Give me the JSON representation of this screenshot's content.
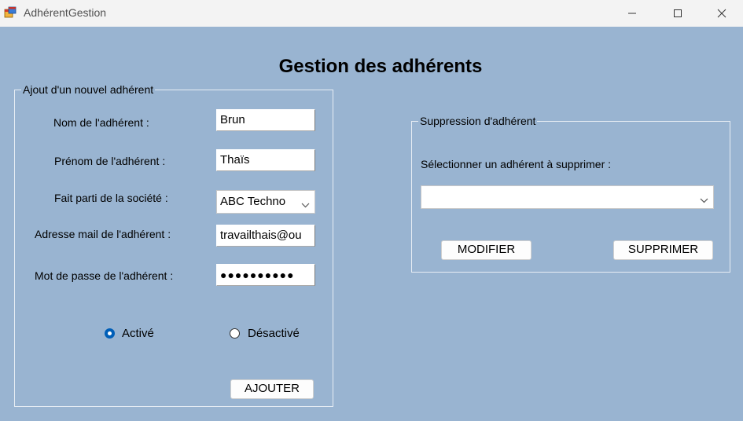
{
  "window": {
    "title": "AdhérentGestion",
    "icons": {
      "app": "app-window-icon",
      "minimize": "minimize-icon",
      "maximize": "maximize-icon",
      "close": "close-icon"
    }
  },
  "page": {
    "title": "Gestion des adhérents"
  },
  "add_group": {
    "legend": "Ajout d'un nouvel adhérent",
    "lastname_label": "Nom de l'adhérent :",
    "lastname_value": "Brun",
    "firstname_label": "Prénom de l'adhérent :",
    "firstname_value": "Thaïs",
    "company_label": "Fait parti de la société :",
    "company_value": "ABC Techno",
    "email_label": "Adresse mail de l'adhérent :",
    "email_value": "travailthais@ou",
    "password_label": "Mot de passe de l'adhérent :",
    "password_mask": "●●●●●●●●●●",
    "radio_active_label": "Activé",
    "radio_inactive_label": "Désactivé",
    "radio_selected": "Activé",
    "add_button": "AJOUTER"
  },
  "delete_group": {
    "legend": "Suppression d'adhérent",
    "select_label": "Sélectionner un adhérent à supprimer :",
    "select_value": "",
    "modify_button": "MODIFIER",
    "delete_button": "SUPPRIMER"
  },
  "colors": {
    "background": "#99B4D1",
    "titlebar": "#F3F3F3",
    "radio_accent": "#005FB8"
  }
}
